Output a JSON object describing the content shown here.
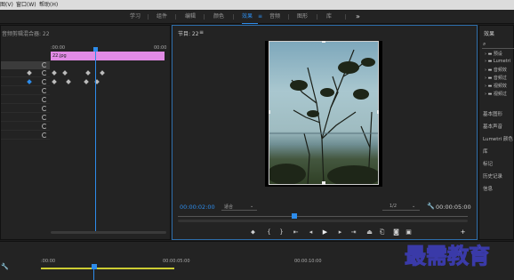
{
  "menubar": {
    "items": [
      "图(V)",
      "窗口(W)",
      "帮助(H)"
    ]
  },
  "workspaces": {
    "tabs": [
      "学习",
      "组件",
      "编辑",
      "颜色",
      "效果",
      "音频",
      "图形",
      "库"
    ],
    "active_index": 4,
    "more_label": "»",
    "active_menu_icon": "≡"
  },
  "effect_controls": {
    "title": "音频剪辑混合器: 22",
    "timecode_start": ":00:00",
    "timecode_end": "00:00",
    "clip_name": "22.jpg",
    "clip_color": "#e18be5"
  },
  "program_monitor": {
    "title": "节目: 22",
    "menu_icon": "≡",
    "timecode_current": "00:00:02:00",
    "fit_select": "适合",
    "resolution_select": "1/2",
    "timecode_total": "00:00:05:00"
  },
  "controls": [
    "marker",
    "in",
    "out",
    "goto-in",
    "step-back",
    "play",
    "step-forward",
    "goto-out",
    "lift",
    "extract",
    "export-frame",
    "button-editor"
  ],
  "right_panel": {
    "title": "效果",
    "search_icon": "⌕",
    "folders": [
      "预设",
      "Lumetri",
      "音频效",
      "音频过",
      "视频效",
      "视频过"
    ],
    "items": [
      "基本图形",
      "基本声音",
      "Lumetri 颜色",
      "库",
      "标记",
      "历史记录",
      "信息"
    ]
  },
  "timeline": {
    "ticks": [
      ":00:00",
      "00:00:05:00",
      "00:00:10:00"
    ]
  },
  "watermark": "最需教育",
  "colors": {
    "accent": "#2d8ceb",
    "clip": "#e18be5",
    "timeline_bar": "#cccc33"
  }
}
